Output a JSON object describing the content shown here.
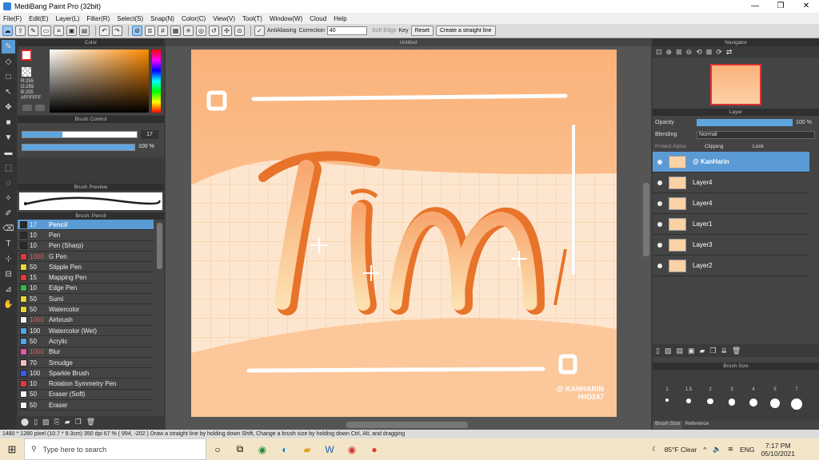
{
  "window": {
    "title": "MediBang Paint Pro (32bit)",
    "minimize": "—",
    "maximize": "❐",
    "close": "✕"
  },
  "menu": [
    "File(F)",
    "Edit(E)",
    "Layer(L)",
    "Filter(R)",
    "Select(S)",
    "Snap(N)",
    "Color(C)",
    "View(V)",
    "Tool(T)",
    "Window(W)",
    "Cloud",
    "Help"
  ],
  "toolbar": {
    "antialias": "AntiAliasing",
    "correction_label": "Correction",
    "correction_value": "40",
    "soft_edge": "Soft Edge",
    "key": "Key",
    "reset": "Reset",
    "straight": "Create a straight line"
  },
  "color_panel": {
    "title": "Color",
    "r": "R:255",
    "g": "G:255",
    "b": "B:255",
    "hex": "#FFFFFF"
  },
  "brush_control": {
    "title": "Brush Control",
    "size": "17",
    "opacity": "100 %"
  },
  "brush_preview": {
    "title": "Brush Preview"
  },
  "brush_panel": {
    "title": "Brush: Pencil",
    "items": [
      {
        "size": "17",
        "name": "Pencil",
        "color": "#2a2a2a"
      },
      {
        "size": "10",
        "name": "Pen",
        "color": "#2a2a2a"
      },
      {
        "size": "10",
        "name": "Pen (Sharp)",
        "color": "#2a2a2a"
      },
      {
        "size": "1000",
        "name": "G Pen",
        "color": "#e23a3a"
      },
      {
        "size": "50",
        "name": "Stipple Pen",
        "color": "#e8d53a"
      },
      {
        "size": "15",
        "name": "Mapping Pen",
        "color": "#e23a3a"
      },
      {
        "size": "10",
        "name": "Edge Pen",
        "color": "#36b84a"
      },
      {
        "size": "50",
        "name": "Sumi",
        "color": "#e8d53a"
      },
      {
        "size": "50",
        "name": "Watercolor",
        "color": "#e8d53a"
      },
      {
        "size": "1000",
        "name": "Airbrush",
        "color": "#f5f5f5"
      },
      {
        "size": "100",
        "name": "Watercolor (Wet)",
        "color": "#4fa7e8"
      },
      {
        "size": "50",
        "name": "Acrylic",
        "color": "#4fa7e8"
      },
      {
        "size": "1000",
        "name": "Blur",
        "color": "#e05aa0"
      },
      {
        "size": "70",
        "name": "Smudge",
        "color": "#f0c0c0"
      },
      {
        "size": "100",
        "name": "Sparkle Brush",
        "color": "#3a5ae8"
      },
      {
        "size": "10",
        "name": "Rotation Symmetry Pen",
        "color": "#e23a3a"
      },
      {
        "size": "50",
        "name": "Eraser (Soft)",
        "color": "#f5f5f5"
      },
      {
        "size": "50",
        "name": "Eraser",
        "color": "#f5f5f5"
      }
    ]
  },
  "canvas": {
    "title": "Untitled",
    "watermark1": "@ KANHARIN",
    "watermark2": "#HD247",
    "art_text": "Tim"
  },
  "navigator": {
    "title": "Navigator"
  },
  "layer_panel": {
    "title": "Layer",
    "opacity_label": "Opacity",
    "opacity_value": "100 %",
    "blending_label": "Blending",
    "blending_value": "Normal",
    "protect": "Protect Alpha",
    "clipping": "Clipping",
    "lock": "Lock",
    "layers": [
      {
        "name": "@ KanHarin"
      },
      {
        "name": "Layer4"
      },
      {
        "name": "Layer4"
      },
      {
        "name": "Layer1"
      },
      {
        "name": "Layer3"
      },
      {
        "name": "Layer2"
      }
    ]
  },
  "brush_size_panel": {
    "title": "Brush Size",
    "sizes": [
      "1",
      "1.5",
      "2",
      "3",
      "4",
      "5",
      "7"
    ],
    "tab1": "Brush Size",
    "tab2": "Reference"
  },
  "status": "1480 * 1280 pixel  (10.7 * 9.3cm)  350 dpi  67 %  ( 994, -202 )  Draw a straight line by holding down Shift, Change a brush size by holding down Ctrl, Alt, and dragging",
  "taskbar": {
    "search": "Type here to search",
    "weather": "85°F  Clear",
    "lang": "ENG",
    "time": "7:17 PM",
    "date": "05/10/2021"
  }
}
